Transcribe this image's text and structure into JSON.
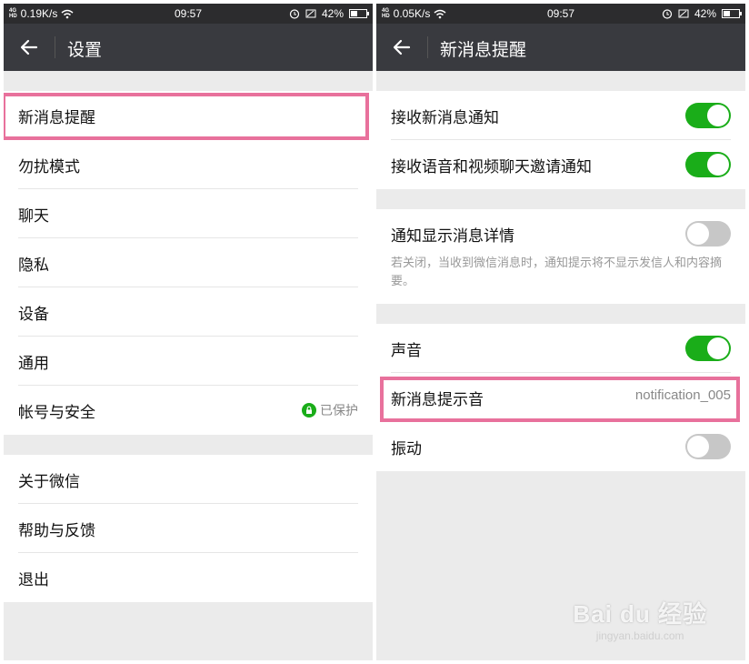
{
  "left": {
    "status": {
      "network": "0.19K/s",
      "time": "09:57",
      "battery": "42%"
    },
    "header": {
      "title": "设置"
    },
    "groups": [
      [
        {
          "label": "新消息提醒"
        },
        {
          "label": "勿扰模式"
        },
        {
          "label": "聊天"
        },
        {
          "label": "隐私"
        },
        {
          "label": "设备"
        },
        {
          "label": "通用"
        },
        {
          "label": "帐号与安全",
          "value": "已保护"
        }
      ],
      [
        {
          "label": "关于微信"
        },
        {
          "label": "帮助与反馈"
        },
        {
          "label": "退出"
        }
      ]
    ]
  },
  "right": {
    "status": {
      "network": "0.05K/s",
      "time": "09:57",
      "battery": "42%"
    },
    "header": {
      "title": "新消息提醒"
    },
    "group1": [
      {
        "label": "接收新消息通知",
        "toggle": "on"
      },
      {
        "label": "接收语音和视频聊天邀请通知",
        "toggle": "on"
      }
    ],
    "group2": {
      "label": "通知显示消息详情",
      "toggle": "off",
      "note": "若关闭，当收到微信消息时，通知提示将不显示发信人和内容摘要。"
    },
    "group3": [
      {
        "label": "声音",
        "toggle": "on"
      },
      {
        "label": "新消息提示音",
        "value": "notification_005"
      },
      {
        "label": "振动",
        "toggle": "off"
      }
    ]
  },
  "watermark": {
    "main": "Bai du 经验",
    "sub": "jingyan.baidu.com"
  },
  "colors": {
    "accent_green": "#1aad19",
    "highlight_pink": "#e8719c",
    "titlebar": "#393a3f"
  },
  "icons": [
    "back-arrow-icon",
    "lock-icon",
    "wifi-icon",
    "alarm-icon",
    "battery-icon"
  ]
}
